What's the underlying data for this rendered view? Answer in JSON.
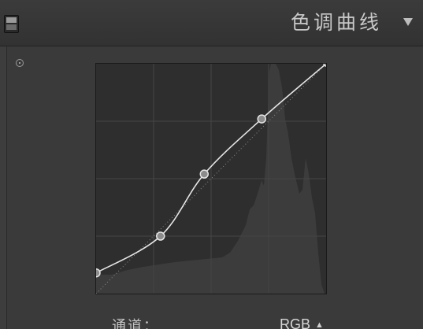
{
  "panel": {
    "title": "色调曲线"
  },
  "curve": {
    "control_points": [
      {
        "input": 0.0,
        "output": 0.09
      },
      {
        "input": 0.28,
        "output": 0.25
      },
      {
        "input": 0.47,
        "output": 0.52
      },
      {
        "input": 0.72,
        "output": 0.76
      },
      {
        "input": 1.0,
        "output": 1.0
      }
    ]
  },
  "channel": {
    "label": "通道：",
    "value": "RGB"
  },
  "colors": {
    "curve_line": "#e6e6e6",
    "grid_bg": "#2e2e2e",
    "histogram": "#3c3c3c"
  }
}
